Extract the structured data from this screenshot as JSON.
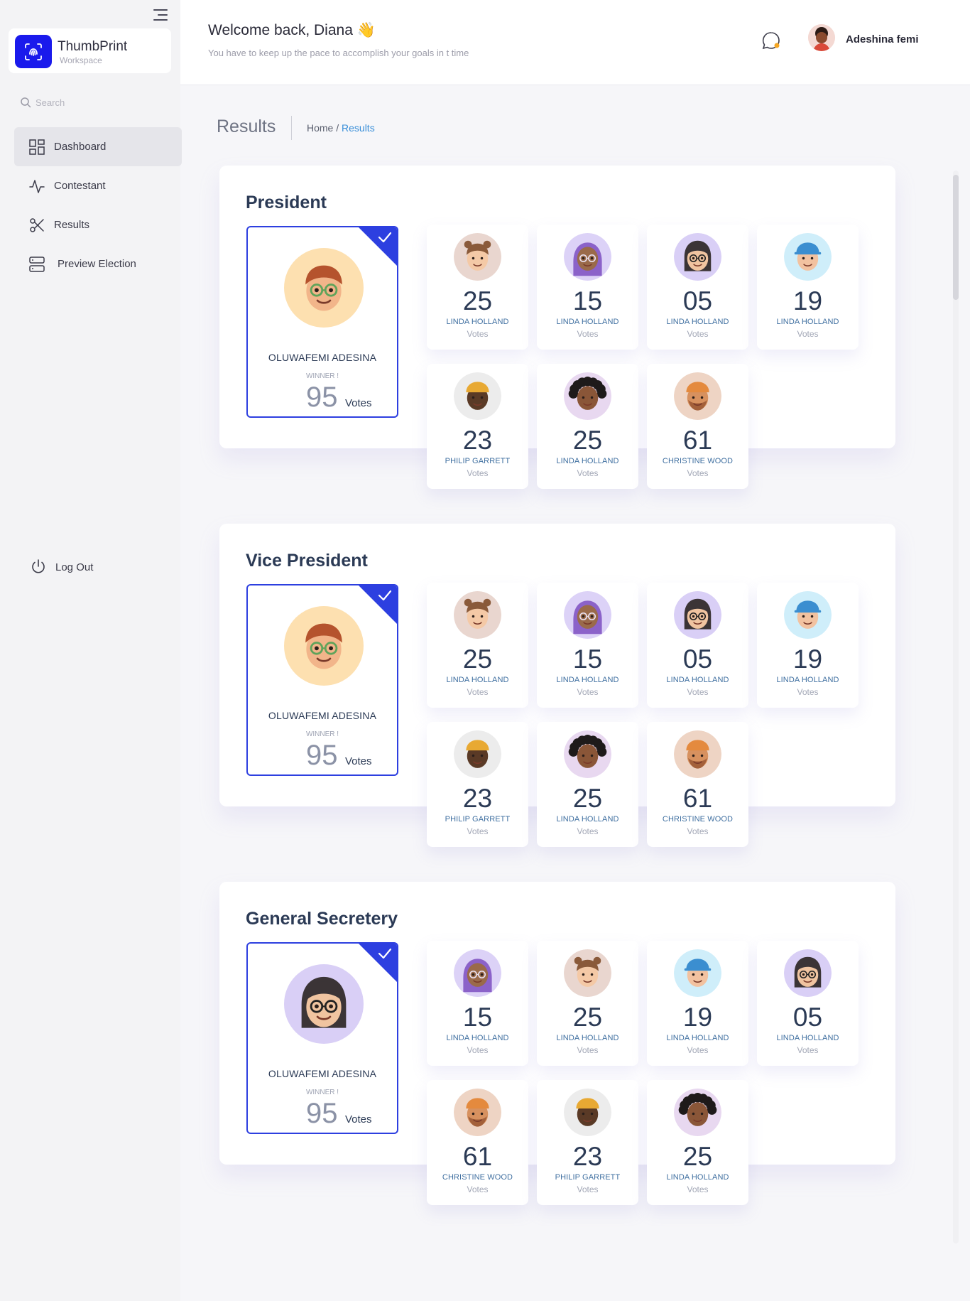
{
  "sidebar": {
    "brand_name": "ThumbPrint",
    "brand_sub": "Workspace",
    "search_placeholder": "Search",
    "items": [
      {
        "label": "Dashboard",
        "icon": "grid-icon",
        "active": true
      },
      {
        "label": "Contestant",
        "icon": "activity-icon",
        "active": false
      },
      {
        "label": "Results",
        "icon": "scissors-icon",
        "active": false
      },
      {
        "label": "Preview Election",
        "icon": "server-icon",
        "active": false
      }
    ],
    "logout": "Log Out"
  },
  "header": {
    "welcome": "Welcome back, Diana 👋",
    "subtitle": "You have to keep up the pace to accomplish your goals in t time",
    "user_name": "Adeshina femi"
  },
  "page": {
    "title": "Results",
    "breadcrumb_home": "Home /",
    "breadcrumb_current": "Results"
  },
  "sections": [
    {
      "title": "President",
      "winner": {
        "name": "OLUWAFEMI ADESINA",
        "label": "WINNER !",
        "votes": "95",
        "votes_label": "Votes",
        "avatar": "man-red-hair"
      },
      "cards": [
        {
          "votes": "25",
          "name": "LINDA HOLLAND",
          "sub": "Votes",
          "avatar": "girl-buns"
        },
        {
          "votes": "15",
          "name": "LINDA HOLLAND",
          "sub": "Votes",
          "avatar": "woman-hijab"
        },
        {
          "votes": "05",
          "name": "LINDA HOLLAND",
          "sub": "Votes",
          "avatar": "woman-glasses"
        },
        {
          "votes": "19",
          "name": "LINDA HOLLAND",
          "sub": "Votes",
          "avatar": "man-blue-hat"
        },
        {
          "votes": "23",
          "name": "PHILIP GARRETT",
          "sub": "Votes",
          "avatar": "man-beanie"
        },
        {
          "votes": "25",
          "name": "LINDA HOLLAND",
          "sub": "Votes",
          "avatar": "woman-curly"
        },
        {
          "votes": "61",
          "name": "CHRISTINE WOOD",
          "sub": "Votes",
          "avatar": "man-turban"
        }
      ]
    },
    {
      "title": "Vice President",
      "winner": {
        "name": "OLUWAFEMI ADESINA",
        "label": "WINNER !",
        "votes": "95",
        "votes_label": "Votes",
        "avatar": "man-red-hair"
      },
      "cards": [
        {
          "votes": "25",
          "name": "LINDA HOLLAND",
          "sub": "Votes",
          "avatar": "girl-buns"
        },
        {
          "votes": "15",
          "name": "LINDA HOLLAND",
          "sub": "Votes",
          "avatar": "woman-hijab"
        },
        {
          "votes": "05",
          "name": "LINDA HOLLAND",
          "sub": "Votes",
          "avatar": "woman-glasses"
        },
        {
          "votes": "19",
          "name": "LINDA HOLLAND",
          "sub": "Votes",
          "avatar": "man-blue-hat"
        },
        {
          "votes": "23",
          "name": "PHILIP GARRETT",
          "sub": "Votes",
          "avatar": "man-beanie"
        },
        {
          "votes": "25",
          "name": "LINDA HOLLAND",
          "sub": "Votes",
          "avatar": "woman-curly"
        },
        {
          "votes": "61",
          "name": "CHRISTINE WOOD",
          "sub": "Votes",
          "avatar": "man-turban"
        }
      ]
    },
    {
      "title": "General Secretery",
      "winner": {
        "name": "OLUWAFEMI ADESINA",
        "label": "WINNER !",
        "votes": "95",
        "votes_label": "Votes",
        "avatar": "woman-glasses"
      },
      "cards": [
        {
          "votes": "15",
          "name": "LINDA HOLLAND",
          "sub": "Votes",
          "avatar": "woman-hijab"
        },
        {
          "votes": "25",
          "name": "LINDA HOLLAND",
          "sub": "Votes",
          "avatar": "girl-buns"
        },
        {
          "votes": "19",
          "name": "LINDA HOLLAND",
          "sub": "Votes",
          "avatar": "man-blue-hat"
        },
        {
          "votes": "05",
          "name": "LINDA HOLLAND",
          "sub": "Votes",
          "avatar": "woman-glasses"
        },
        {
          "votes": "61",
          "name": "CHRISTINE WOOD",
          "sub": "Votes",
          "avatar": "man-turban"
        },
        {
          "votes": "23",
          "name": "PHILIP GARRETT",
          "sub": "Votes",
          "avatar": "man-beanie"
        },
        {
          "votes": "25",
          "name": "LINDA HOLLAND",
          "sub": "Votes",
          "avatar": "woman-curly"
        }
      ]
    }
  ],
  "colors": {
    "accent": "#2d3fe0",
    "brand": "#1a1aec",
    "link": "#3a8fd9"
  }
}
